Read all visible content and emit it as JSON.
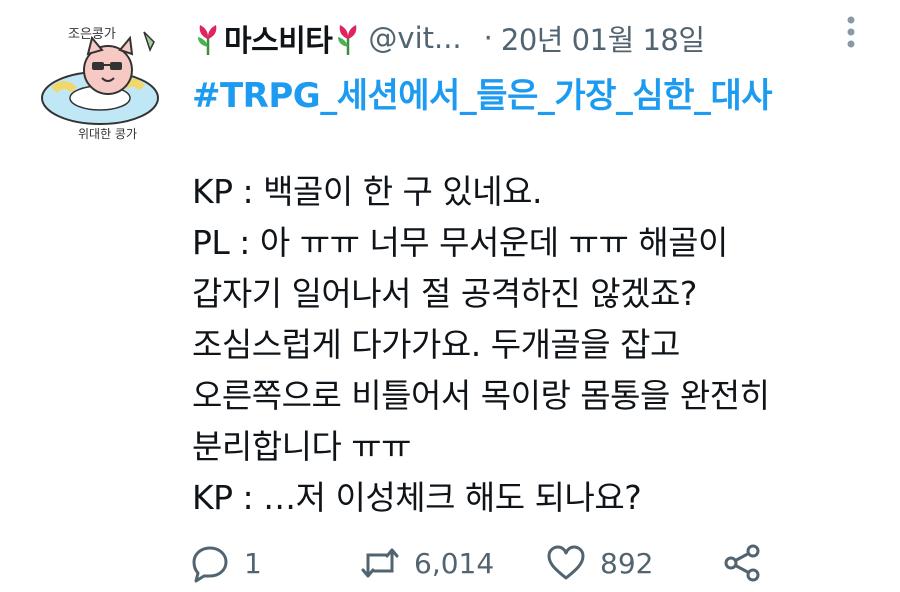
{
  "tweet": {
    "author_name": "마스비타",
    "handle": "@vit...",
    "separator": "·",
    "date": "20년 01월 18일",
    "hashtag": "#TRPG_세션에서_들은_가장_심한_대사",
    "lines": [
      "KP : 백골이 한 구 있네요.",
      "PL : 아 ㅠㅠ 너무 무서운데 ㅠㅠ 해골이",
      "갑자기 일어나서 절 공격하진 않겠죠?",
      "조심스럽게 다가가요. 두개골을 잡고",
      "오른쪽으로 비틀어서 목이랑 몸통을 완전히",
      "분리합니다 ㅠㅠ",
      "KP : …저 이성체크 해도 되나요?"
    ],
    "avatar_text_top": "조은콩가",
    "avatar_text_bottom": "위대한 콩가"
  },
  "actions": {
    "reply_count": "1",
    "retweet_count": "6,014",
    "like_count": "892"
  },
  "colors": {
    "accent": "#1d9bf0",
    "muted": "#536471",
    "tulip": "#e0245e"
  },
  "icons": [
    "avatar-cat",
    "tulip-icon",
    "more-icon",
    "reply-icon",
    "retweet-icon",
    "like-icon",
    "share-icon"
  ]
}
